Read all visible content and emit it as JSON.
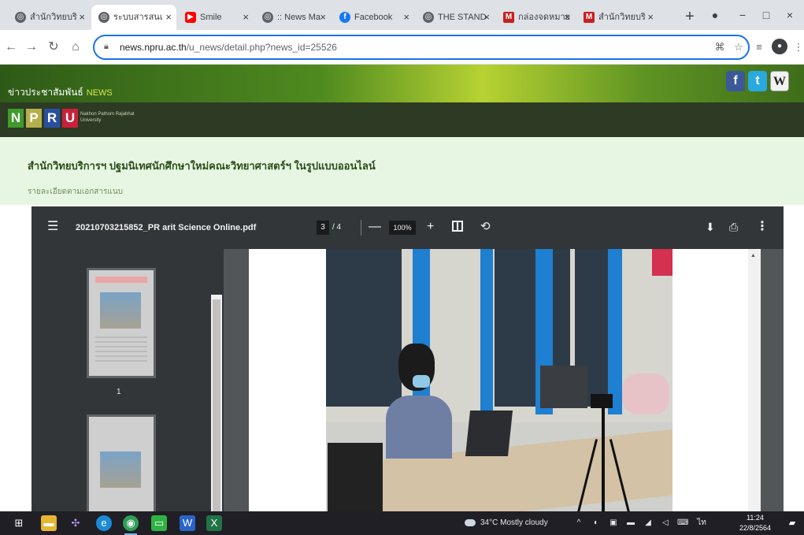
{
  "browser": {
    "tabs": [
      {
        "label": "สำนักวิทยบริ",
        "favicon_color": "#5f6368",
        "active": false
      },
      {
        "label": "ระบบสารสนเ",
        "favicon_color": "#5f6368",
        "active": true
      },
      {
        "label": "Smile",
        "favicon_color": "#ff0000",
        "active": false
      },
      {
        "label": ":: News Ma",
        "favicon_color": "#5f6368",
        "active": false
      },
      {
        "label": "Facebook",
        "favicon_color": "#1877f2",
        "active": false
      },
      {
        "label": "THE STAND",
        "favicon_color": "#5f6368",
        "active": false
      },
      {
        "label": "กล่องจดหมาย",
        "favicon_color": "#c5221f",
        "active": false
      },
      {
        "label": "สำนักวิทยบริ",
        "favicon_color": "#c5221f",
        "active": false
      }
    ],
    "new_tab": "+",
    "url_host": "news.npru.ac.th",
    "url_path": "/u_news/detail.php?news_id=25526"
  },
  "site": {
    "title": "ข่าวประชาสัมพันธ์",
    "title_badge": "NEWS",
    "logo_letters": [
      "N",
      "P",
      "R",
      "U"
    ],
    "logo_subtitle": "Nakhon Pathom Rajabhat University",
    "social": [
      "f",
      "t",
      "W"
    ]
  },
  "article": {
    "title": "สำนักวิทยบริการฯ ปฐมนิเทศนักศึกษาใหม่คณะวิทยาศาสตร์ฯ ในรูปแบบออนไลน์",
    "subtitle": "รายละเอียดตามเอกสารแนบ"
  },
  "pdf": {
    "filename": "20210703215852_PR arit Science Online.pdf",
    "current_page": "3",
    "total_pages": "/ 4",
    "zoom": "100%",
    "thumbnail_label": "1"
  },
  "taskbar": {
    "weather": "34°C  Mostly cloudy",
    "time": "11:24",
    "date": "22/8/2564"
  }
}
